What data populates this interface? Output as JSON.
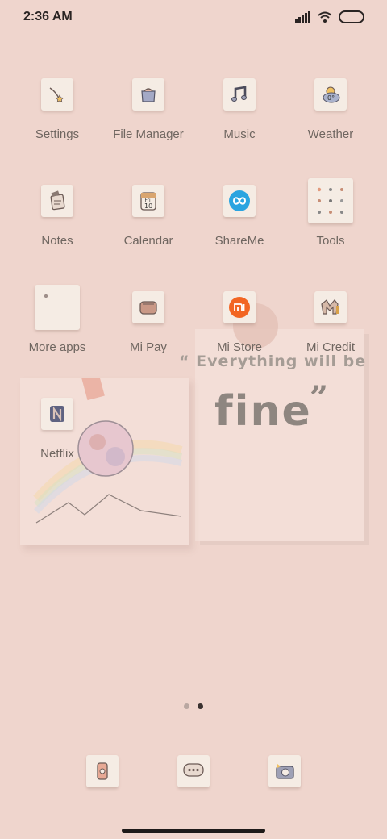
{
  "status_bar": {
    "time": "2:36 AM"
  },
  "apps": [
    {
      "label": "Settings",
      "icon": "shooting-star-icon"
    },
    {
      "label": "File Manager",
      "icon": "folder-bag-icon"
    },
    {
      "label": "Music",
      "icon": "music-note-icon"
    },
    {
      "label": "Weather",
      "icon": "weather-cloud-icon"
    },
    {
      "label": "Notes",
      "icon": "notes-icon"
    },
    {
      "label": "Calendar",
      "icon": "calendar-icon"
    },
    {
      "label": "ShareMe",
      "icon": "shareme-icon"
    },
    {
      "label": "Tools",
      "icon": "tools-folder-icon"
    },
    {
      "label": "More apps",
      "icon": "more-apps-folder-icon"
    },
    {
      "label": "Mi Pay",
      "icon": "wallet-icon"
    },
    {
      "label": "Mi Store",
      "icon": "mi-logo-icon"
    },
    {
      "label": "Mi Credit",
      "icon": "mi-credit-icon"
    },
    {
      "label": "Netflix",
      "icon": "netflix-icon"
    }
  ],
  "calendar_icon": {
    "day": "Fri",
    "date": "10"
  },
  "weather_icon": {
    "temp": "0°"
  },
  "quote_widget": {
    "line1": "“ Everything will be",
    "line2": "fine",
    "close": "”"
  },
  "dock": [
    {
      "icon": "phone-icon"
    },
    {
      "icon": "messages-icon"
    },
    {
      "icon": "camera-icon"
    }
  ],
  "page_indicator": {
    "pages": 2,
    "active": 2
  },
  "colors": {
    "background": "#efd5cd",
    "mi_orange": "#f26522",
    "shareme_blue": "#2aa4e0"
  }
}
